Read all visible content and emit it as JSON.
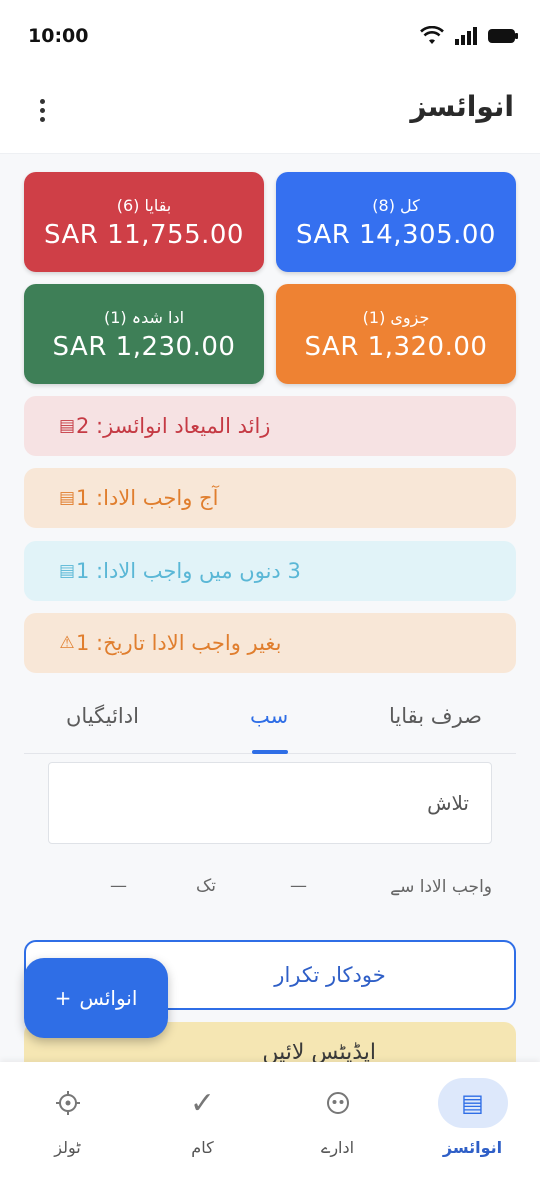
{
  "status_bar": {
    "time": "10:00"
  },
  "app_bar": {
    "title": "انوائسز"
  },
  "summary": {
    "total": {
      "label": "کل (8)",
      "amount": "SAR 14,305.00",
      "color": "#3570f0"
    },
    "remaining": {
      "label": "بقایا (6)",
      "amount": "SAR 11,755.00",
      "color": "#cf3f47"
    },
    "partial": {
      "label": "جزوی (1)",
      "amount": "SAR 1,320.00",
      "color": "#ee8233"
    },
    "paid": {
      "label": "ادا شدہ (1)",
      "amount": "SAR 1,230.00",
      "color": "#3e7f57"
    }
  },
  "alerts": [
    {
      "text": "زائد المیعاد انوائسز: 2",
      "icon": "list-icon",
      "bg": "#f6e2e3",
      "fg": "#c53a44"
    },
    {
      "text": "آج واجب الادا: 1",
      "icon": "list-icon",
      "bg": "#f8e7d7",
      "fg": "#e07e2e"
    },
    {
      "text": "3 دنوں میں واجب الادا: 1",
      "icon": "list-icon",
      "bg": "#e1f3f8",
      "fg": "#5ab7d6"
    },
    {
      "text": "بغیر واجب الادا تاریخ: 1",
      "icon": "warning-icon",
      "bg": "#f8e7d7",
      "fg": "#e07e2e"
    }
  ],
  "tabs": [
    {
      "label": "صرف بقایا"
    },
    {
      "label": "سب"
    },
    {
      "label": "ادائیگیاں"
    }
  ],
  "search": {
    "placeholder": "تلاش"
  },
  "date_filter": {
    "from_label": "واجب الادا سے",
    "from_value": "—",
    "to_label": "تک",
    "to_value": "—"
  },
  "auto_repeat": {
    "label": "خودکار تکرار"
  },
  "updates_banner": {
    "text": "اپڈیٹس لائیں"
  },
  "fab": {
    "label": "انوائس",
    "plus": "+"
  },
  "bottom_nav": [
    {
      "label": "انوائسز",
      "icon": "invoice-list-icon"
    },
    {
      "label": "ادارے",
      "icon": "entities-icon"
    },
    {
      "label": "کام",
      "icon": "check-icon"
    },
    {
      "label": "ٹولز",
      "icon": "tools-icon"
    }
  ]
}
